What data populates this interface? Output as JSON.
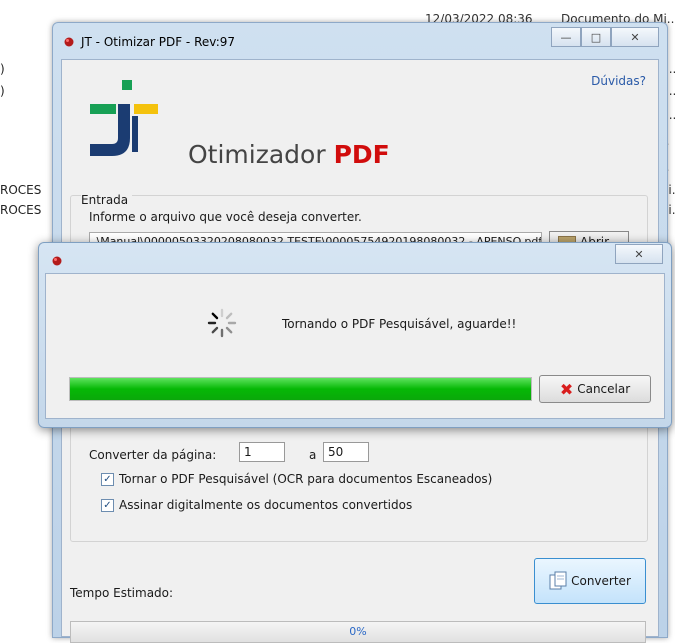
{
  "background": {
    "datetime": "12/03/2022 08:36",
    "doc_label": "Documento do Mi...",
    "left_fragments": [
      ")",
      ")",
      "ROCES",
      "ROCES"
    ],
    "right_fragments": [
      "Ii...",
      "Ii...",
      "Ii...",
      "...",
      "...",
      "Mi...",
      "Mi..."
    ]
  },
  "main": {
    "title": "JT - Otimizar PDF - Rev:97",
    "help_link": "Dúvidas?",
    "app_name": "Otimizador",
    "app_name_accent": "PDF",
    "entrada_label": "Entrada",
    "entrada_hint": "Informe o arquivo que você deseja converter.",
    "file_path": ".\\Manual\\0000050332020808003​2 TESTE\\0000575492019808003​2 - APENSO.pdf",
    "open_label": "Abrir",
    "page_label": "Converter da página:",
    "page_from": "1",
    "page_sep": "a",
    "page_to": "50",
    "ocr_label": "Tornar o PDF Pesquisável (OCR para documentos Escaneados)",
    "sign_label": "Assinar digitalmente os documentos convertidos",
    "convert_label": "Converter",
    "time_label": "Tempo Estimado:",
    "progress_text": "0%",
    "progress_value": 0
  },
  "dialog": {
    "status": "Tornando o PDF Pesquisável, aguarde!!",
    "progress_value": 1.0,
    "cancel_label": "Cancelar"
  },
  "colors": {
    "accent_red": "#d10c0c",
    "progress_green": "#06b806",
    "link_blue": "#2a5aa8"
  },
  "icons": [
    "app-icon",
    "minimize-icon",
    "maximize-icon",
    "close-icon",
    "folder-icon",
    "spinner-icon",
    "cancel-x-icon",
    "convert-document-icon"
  ]
}
